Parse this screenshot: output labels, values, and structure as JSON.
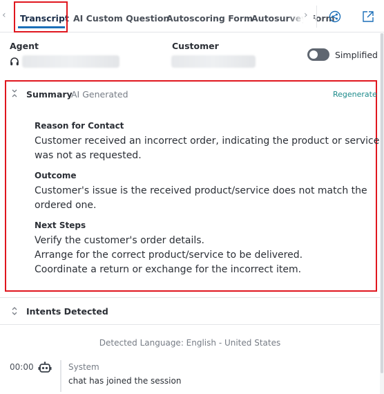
{
  "tabs": [
    {
      "label": "Transcript",
      "active": true
    },
    {
      "label": "AI Custom Question",
      "active": false
    },
    {
      "label": "Autoscoring Form",
      "active": false
    },
    {
      "label": "Autosurvey Form",
      "active": false
    }
  ],
  "toolbar": {
    "prev_icon": "chevron-left-icon",
    "next_icon": "chevron-right-icon",
    "share_icon": "share-icon",
    "popout_icon": "external-link-icon"
  },
  "participants": {
    "agent_label": "Agent",
    "customer_label": "Customer",
    "agent_icon": "headset-icon"
  },
  "view_toggle": {
    "label": "Simplified",
    "on": false
  },
  "summary": {
    "title": "Summary",
    "subtitle": "AI Generated",
    "regenerate_label": "Regenerate",
    "sections": [
      {
        "heading": "Reason for Contact",
        "lines": [
          "Customer received an incorrect order, indicating the product or service",
          "was not as requested."
        ]
      },
      {
        "heading": "Outcome",
        "lines": [
          "Customer's issue is the received product/service does not match the",
          "ordered one."
        ]
      },
      {
        "heading": "Next Steps",
        "lines": [
          "Verify the customer's order details.",
          "Arrange for the correct product/service to be delivered.",
          "Coordinate a return or exchange for the incorrect item."
        ]
      }
    ]
  },
  "intents": {
    "title": "Intents Detected"
  },
  "language": "Detected Language: English - United States",
  "transcript": [
    {
      "time": "00:00",
      "sender": "System",
      "text": "chat has joined the session",
      "icon": "bot-icon"
    }
  ],
  "colors": {
    "highlight": "#e0161e",
    "accent": "#1b6fb8",
    "link": "#1a8a8a"
  }
}
